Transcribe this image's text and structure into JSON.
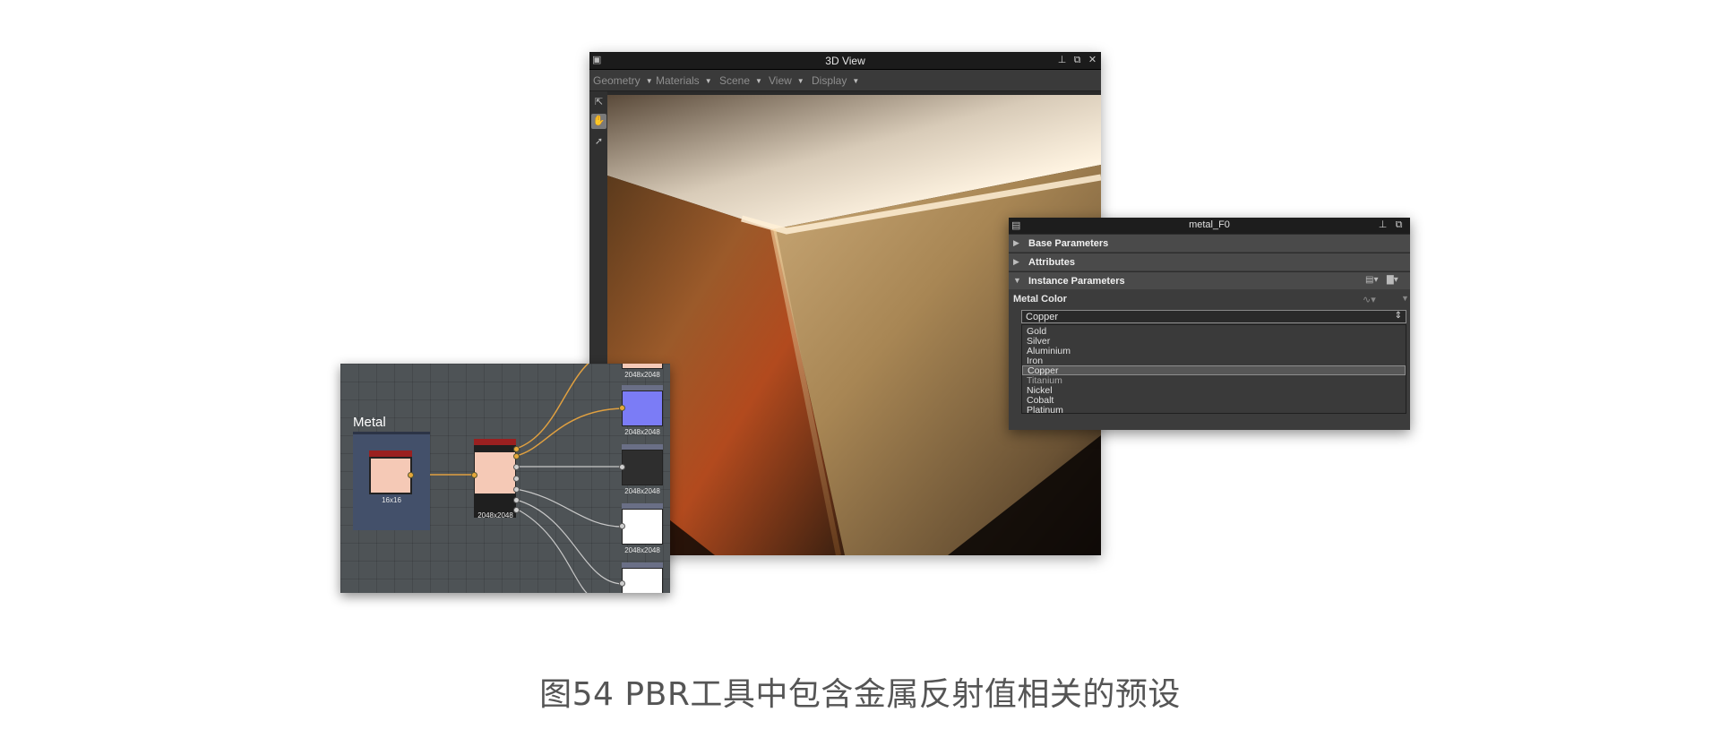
{
  "view3d": {
    "title": "3D View",
    "menus": [
      {
        "label": "Geometry"
      },
      {
        "label": "Materials"
      },
      {
        "label": "Scene"
      },
      {
        "label": "View"
      },
      {
        "label": "Display"
      }
    ],
    "tools": [
      "export-icon",
      "hand-icon",
      "pointer-icon"
    ]
  },
  "graph": {
    "frame_title": "Metal",
    "nodes": {
      "uniform_color_size": "16x16",
      "mix_size": "2048x2048"
    },
    "outputs": [
      "2048x2048",
      "2048x2048",
      "2048x2048",
      "2048x2048"
    ]
  },
  "params": {
    "title": "metal_F0",
    "sections": [
      "Base Parameters",
      "Attributes",
      "Instance Parameters"
    ],
    "metal_color_label": "Metal Color",
    "selected_value": "Copper",
    "options": [
      "Gold",
      "Silver",
      "Aluminium",
      "Iron",
      "Copper",
      "Titanium",
      "Nickel",
      "Cobalt",
      "Platinum"
    ],
    "selected_index": 4
  },
  "caption": "图54 PBR工具中包含金属反射值相关的预设"
}
